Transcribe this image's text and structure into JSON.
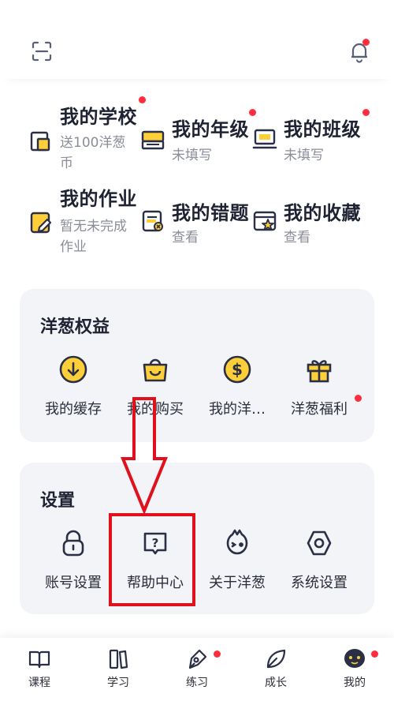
{
  "header": {
    "scan_icon": "scan-icon",
    "bell_icon": "bell-icon",
    "accent": "#ff2d3d"
  },
  "profile_grid": [
    {
      "title": "我的学校",
      "sub": "送100洋葱币",
      "icon": "school-icon",
      "dot": true
    },
    {
      "title": "我的年级",
      "sub": "未填写",
      "icon": "grade-icon",
      "dot": true
    },
    {
      "title": "我的班级",
      "sub": "未填写",
      "icon": "class-icon",
      "dot": true
    },
    {
      "title": "我的作业",
      "sub": "暂无未完成作业",
      "icon": "homework-icon",
      "dot": false
    },
    {
      "title": "我的错题",
      "sub": "查看",
      "icon": "mistakes-icon",
      "dot": false
    },
    {
      "title": "我的收藏",
      "sub": "查看",
      "icon": "favorites-icon",
      "dot": false
    }
  ],
  "benefits": {
    "title": "洋葱权益",
    "items": [
      {
        "label": "我的缓存",
        "icon": "download-icon"
      },
      {
        "label": "我的购买",
        "icon": "shopping-bag-icon"
      },
      {
        "label": "我的洋…",
        "icon": "coin-icon"
      },
      {
        "label": "洋葱福利",
        "icon": "gift-icon"
      }
    ]
  },
  "settings": {
    "title": "设置",
    "items": [
      {
        "label": "账号设置",
        "icon": "lock-icon"
      },
      {
        "label": "帮助中心",
        "icon": "help-icon"
      },
      {
        "label": "关于洋葱",
        "icon": "onion-face-icon"
      },
      {
        "label": "系统设置",
        "icon": "settings-icon"
      }
    ]
  },
  "tabbar": {
    "items": [
      {
        "label": "课程",
        "icon": "book-icon"
      },
      {
        "label": "学习",
        "icon": "study-icon"
      },
      {
        "label": "练习",
        "icon": "practice-icon"
      },
      {
        "label": "成长",
        "icon": "leaf-icon"
      },
      {
        "label": "我的",
        "icon": "avatar-icon"
      }
    ]
  },
  "colors": {
    "icon_yellow": "#ffcf3a",
    "icon_stroke": "#2b2f45",
    "card_bg": "#f3f4f7",
    "annotation_red": "#e0101c"
  }
}
